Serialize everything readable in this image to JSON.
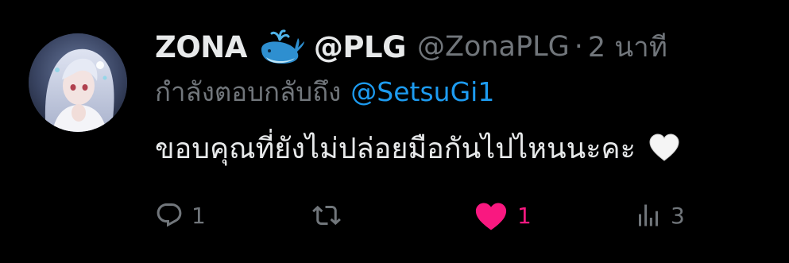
{
  "tweet": {
    "display_name": "ZONA",
    "name_emoji": "whale-emoji-icon",
    "name_suffix": "@PLG",
    "handle": "@ZonaPLG",
    "separator": "·",
    "time": "2 นาที",
    "reply_prefix": "กำลังตอบกลับถึง",
    "reply_to": "@SetsuGi1",
    "text": "ขอบคุณที่ยังไม่ปล่อยมือกันไปไหนนะคะ",
    "text_emoji": "white-heart-emoji-icon"
  },
  "actions": {
    "reply_count": "1",
    "retweet_count": "",
    "like_count": "1",
    "views_count": "3"
  },
  "colors": {
    "background": "#000000",
    "text_primary": "#e7e9ea",
    "text_secondary": "#71767b",
    "link": "#1d9bf0",
    "like": "#f91880"
  }
}
